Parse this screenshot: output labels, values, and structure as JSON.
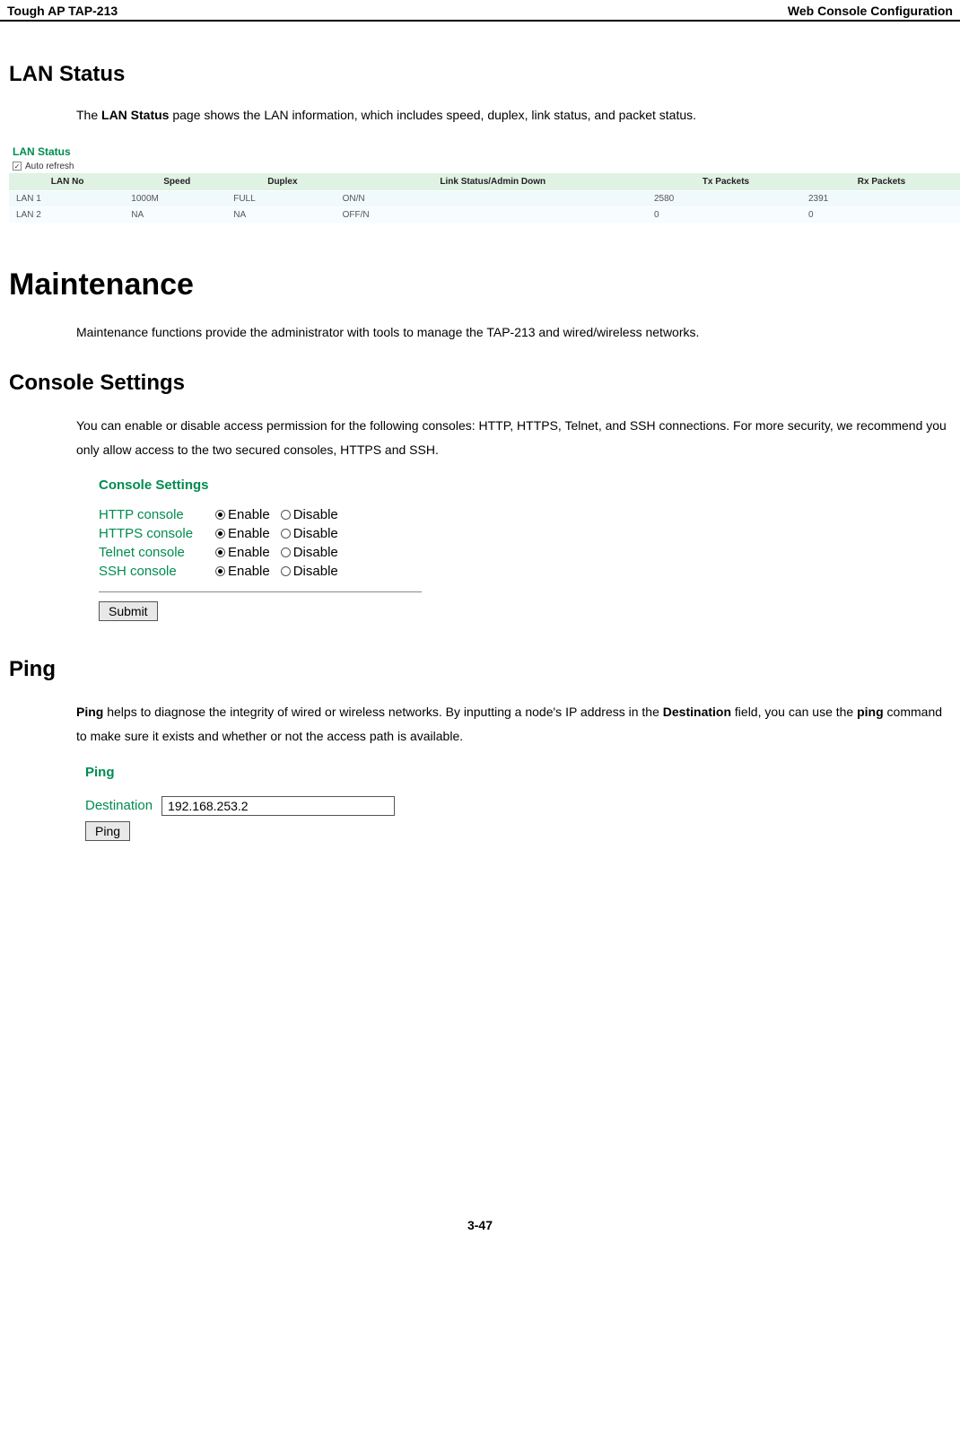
{
  "header": {
    "left": "Tough AP TAP-213",
    "right": "Web Console Configuration"
  },
  "lan_status_section": {
    "heading": "LAN Status",
    "intro_pre": "The ",
    "intro_bold": "LAN Status",
    "intro_post": " page shows the LAN information, which includes speed, duplex, link status, and packet status."
  },
  "lan_status_fig": {
    "title": "LAN Status",
    "auto_refresh_label": "Auto refresh",
    "auto_refresh_checked": "✓",
    "columns": [
      "LAN No",
      "Speed",
      "Duplex",
      "Link Status/Admin Down",
      "Tx Packets",
      "Rx Packets"
    ],
    "rows": [
      {
        "lan": "LAN 1",
        "speed": "1000M",
        "duplex": "FULL",
        "link": "ON/N",
        "tx": "2580",
        "rx": "2391"
      },
      {
        "lan": "LAN 2",
        "speed": "NA",
        "duplex": "NA",
        "link": "OFF/N",
        "tx": "0",
        "rx": "0"
      }
    ]
  },
  "maintenance_section": {
    "heading": "Maintenance",
    "intro": "Maintenance functions provide the administrator with tools to manage the TAP-213 and wired/wireless networks."
  },
  "console_section": {
    "heading": "Console Settings",
    "intro": "You can enable or disable access permission for the following consoles: HTTP, HTTPS, Telnet, and SSH connections. For more security, we recommend you only allow access to the two secured consoles, HTTPS and SSH."
  },
  "console_fig": {
    "title": "Console Settings",
    "enable": "Enable",
    "disable": "Disable",
    "rows": [
      {
        "label": "HTTP console",
        "selected": "enable"
      },
      {
        "label": "HTTPS console",
        "selected": "enable"
      },
      {
        "label": "Telnet console",
        "selected": "enable"
      },
      {
        "label": "SSH console",
        "selected": "enable"
      }
    ],
    "submit": "Submit"
  },
  "ping_section": {
    "heading": "Ping",
    "p_1": "Ping",
    "p_2": " helps to diagnose the integrity of wired or wireless networks. By inputting a node's IP address in the ",
    "p_3": "Destination",
    "p_4": " field, you can use the ",
    "p_5": "ping",
    "p_6": " command to make sure it exists and whether or not the access path is available."
  },
  "ping_fig": {
    "title": "Ping",
    "dest_label": "Destination",
    "dest_value": "192.168.253.2",
    "button": "Ping"
  },
  "footer": {
    "page": "3-47"
  }
}
